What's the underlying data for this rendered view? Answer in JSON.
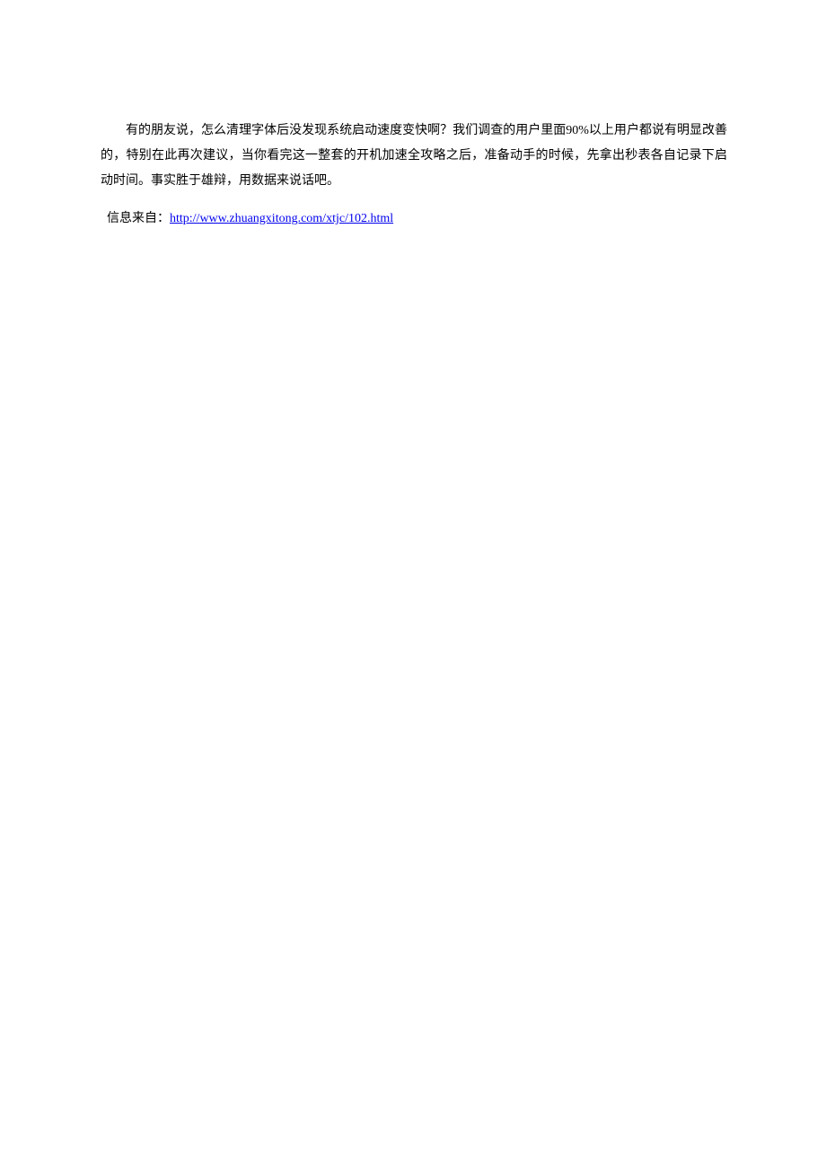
{
  "body": {
    "paragraph": "有的朋友说，怎么清理字体后没发现系统启动速度变快啊？我们调查的用户里面90%以上用户都说有明显改善的，特别在此再次建议，当你看完这一整套的开机加速全攻略之后，准备动手的时候，先拿出秒表各自记录下启动时间。事实胜于雄辩，用数据来说话吧。",
    "source_label": "信息来自：",
    "source_url": "http://www.zhuangxitong.com/xtjc/102.html"
  }
}
